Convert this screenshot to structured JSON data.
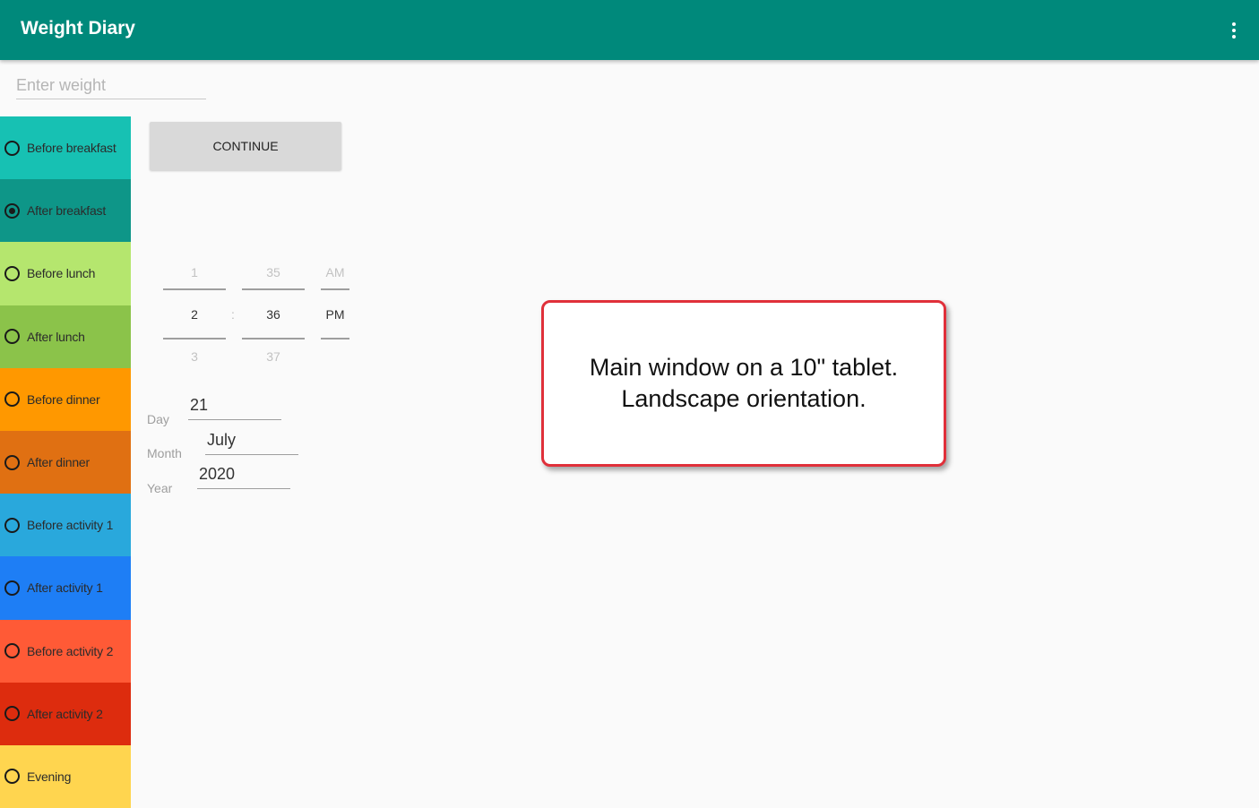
{
  "app": {
    "title": "Weight Diary",
    "menu_icon": "more-vert-icon"
  },
  "weight_input": {
    "placeholder": "Enter weight",
    "value": ""
  },
  "period_options": [
    {
      "label": "Before breakfast",
      "color": "#17c1b3",
      "checked": false
    },
    {
      "label": "After breakfast",
      "color": "#0e9688",
      "checked": true
    },
    {
      "label": "Before lunch",
      "color": "#b5e66e",
      "checked": false
    },
    {
      "label": "After lunch",
      "color": "#8bc34a",
      "checked": false
    },
    {
      "label": "Before dinner",
      "color": "#ff9800",
      "checked": false
    },
    {
      "label": "After dinner",
      "color": "#e07012",
      "checked": false
    },
    {
      "label": "Before activity 1",
      "color": "#29a8dc",
      "checked": false
    },
    {
      "label": "After activity 1",
      "color": "#1e7ef5",
      "checked": false
    },
    {
      "label": "Before activity 2",
      "color": "#ff5a36",
      "checked": false
    },
    {
      "label": "After activity 2",
      "color": "#dd2c0e",
      "checked": false
    },
    {
      "label": "Evening",
      "color": "#ffd54f",
      "checked": false
    }
  ],
  "continue_label": "CONTINUE",
  "time_picker": {
    "hour": {
      "prev": "1",
      "current": "2",
      "next": "3"
    },
    "separator": ":",
    "minute": {
      "prev": "35",
      "current": "36",
      "next": "37"
    },
    "ampm": {
      "prev": "AM",
      "current": "PM"
    }
  },
  "date": {
    "day_label": "Day",
    "day_value": "21",
    "month_label": "Month",
    "month_value": "July",
    "year_label": "Year",
    "year_value": "2020"
  },
  "callout": {
    "line1": "Main window on a 10\" tablet.",
    "line2": "Landscape orientation."
  },
  "colors": {
    "app_bar": "#00897b",
    "callout_border": "#e0303a"
  }
}
